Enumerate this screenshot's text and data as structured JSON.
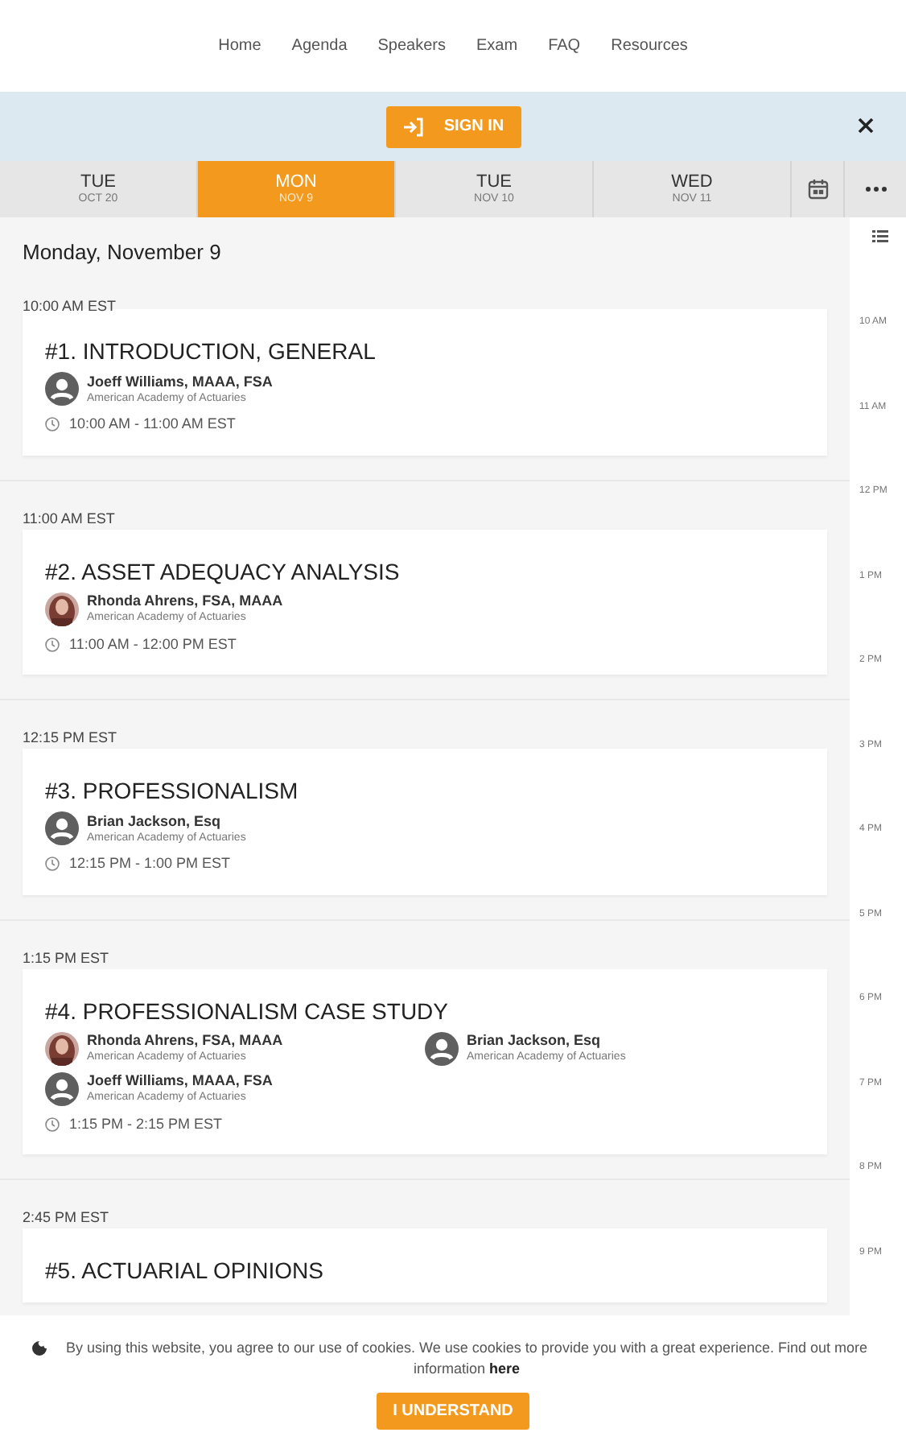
{
  "nav": [
    "Home",
    "Agenda",
    "Speakers",
    "Exam",
    "FAQ",
    "Resources"
  ],
  "sign_in": {
    "label": "SIGN IN"
  },
  "days": [
    {
      "day": "TUE",
      "date": "OCT 20",
      "selected": false
    },
    {
      "day": "MON",
      "date": "NOV 9",
      "selected": true
    },
    {
      "day": "TUE",
      "date": "NOV 10",
      "selected": false
    },
    {
      "day": "WED",
      "date": "NOV 11",
      "selected": false
    }
  ],
  "heading": "Monday, November 9",
  "sessions": [
    {
      "start": "10:00 AM EST",
      "title": "#1. INTRODUCTION, GENERAL",
      "speakers": [
        {
          "name": "Joeff Williams, MAAA, FSA",
          "org": "American Academy of Actuaries",
          "kind": "generic"
        }
      ],
      "time": "10:00 AM - 11:00 AM EST"
    },
    {
      "start": "11:00 AM EST",
      "title": "#2. ASSET ADEQUACY ANALYSIS",
      "speakers": [
        {
          "name": "Rhonda Ahrens, FSA, MAAA",
          "org": "American Academy of Actuaries"
        }
      ],
      "time": "11:00 AM - 12:00 PM EST"
    },
    {
      "start": "12:15 PM EST",
      "title": "#3. PROFESSIONALISM",
      "speakers": [
        {
          "name": "Brian Jackson, Esq",
          "org": "American Academy of Actuaries",
          "kind": "generic"
        }
      ],
      "time": "12:15 PM - 1:00 PM EST"
    },
    {
      "start": "1:15 PM EST",
      "title": "#4. PROFESSIONALISM CASE STUDY",
      "speakers": [
        {
          "name": "Rhonda Ahrens, FSA, MAAA",
          "org": "American Academy of Actuaries"
        },
        {
          "name": "Brian Jackson, Esq",
          "org": "American Academy of Actuaries",
          "kind": "generic"
        },
        {
          "name": "Joeff Williams, MAAA, FSA",
          "org": "American Academy of Actuaries",
          "kind": "generic"
        }
      ],
      "time": "1:15 PM - 2:15 PM EST"
    },
    {
      "start": "2:45 PM EST",
      "title": "#5. ACTUARIAL OPINIONS"
    }
  ],
  "timeline": [
    "10 AM",
    "11 AM",
    "12 PM",
    "1 PM",
    "2 PM",
    "3 PM",
    "4 PM",
    "5 PM",
    "6 PM",
    "7 PM",
    "8 PM",
    "9 PM"
  ],
  "cookie": {
    "text": "By using this website, you agree to our use of cookies. We use cookies to provide you with a great experience. Find out more information",
    "link": "here",
    "button": "I UNDERSTAND"
  }
}
